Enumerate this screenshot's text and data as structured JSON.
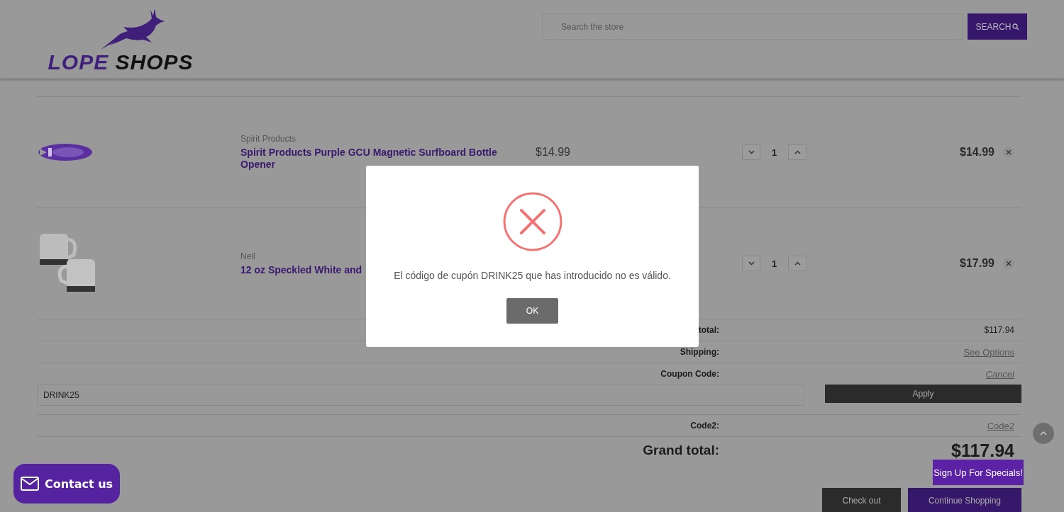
{
  "header": {
    "logo": [
      "LOPE",
      "SHOPS"
    ],
    "search": {
      "placeholder": "Search the store",
      "button": "SEARCH"
    }
  },
  "cart": {
    "items": [
      {
        "brand": "Spirit Products",
        "name": "Spirit Products Purple GCU Magnetic Surfboard Bottle Opener",
        "price": "$14.99",
        "quantity": "1",
        "total": "$14.99"
      },
      {
        "brand": "Neil",
        "name": "12 oz Speckled White and",
        "quantity": "1",
        "total": "$17.99"
      }
    ]
  },
  "totals": [
    {
      "kind": "value",
      "label": "total:",
      "value": "$117.94"
    },
    {
      "kind": "link",
      "label": "Shipping:",
      "value": "See Options"
    },
    {
      "kind": "cancel",
      "label": "Coupon Code:",
      "value": "Cancel"
    },
    {
      "kind": "coupon",
      "value": "DRINK25",
      "button": "Apply"
    },
    {
      "kind": "link",
      "label": "Code2:",
      "value": "Code2"
    },
    {
      "kind": "grand",
      "label": "Grand total:",
      "value": "$117.94"
    }
  ],
  "actions": [
    "Check out",
    "Continue Shopping"
  ],
  "contact": "Contact us",
  "signup": "Sign Up For Specials!",
  "modal": {
    "message": "El código de cupón DRINK25 que has introducido no es válido.",
    "button": "OK"
  }
}
